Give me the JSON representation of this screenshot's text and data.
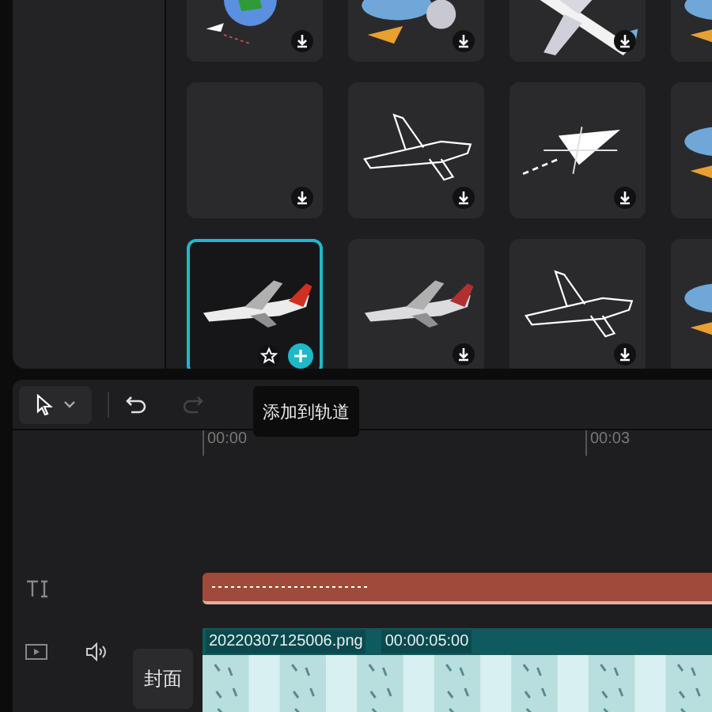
{
  "sticker_grid": [
    {
      "selected": false
    },
    {
      "selected": false
    },
    {
      "selected": false
    },
    {
      "selected": false
    },
    {
      "selected": false
    },
    {
      "selected": false
    },
    {
      "selected": false
    },
    {
      "selected": false
    },
    {
      "selected": true
    },
    {
      "selected": false
    },
    {
      "selected": false
    },
    {
      "selected": false
    }
  ],
  "tooltip": "添加到轨道",
  "toolbar": {
    "redo_disabled": true
  },
  "ruler": [
    "00:00",
    "00:03"
  ],
  "video_clip": {
    "name": "20220307125006.png",
    "duration": "00:00:05:00"
  },
  "cover_button": "封面"
}
